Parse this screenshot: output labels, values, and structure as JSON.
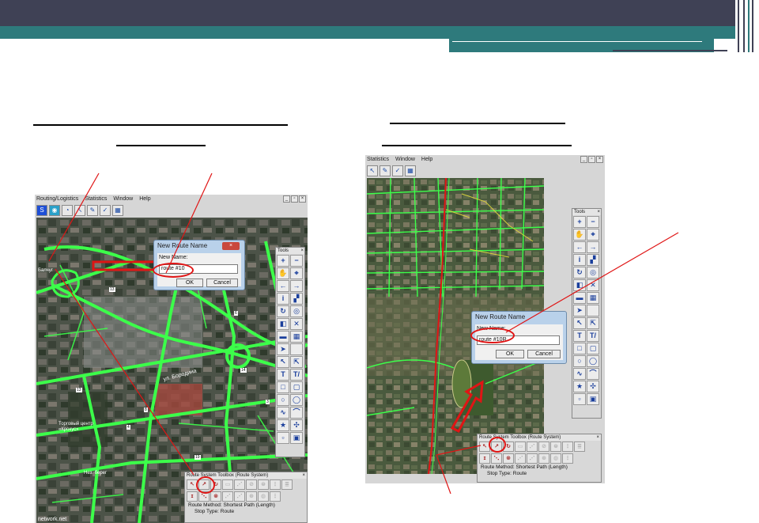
{
  "left_window": {
    "menu": [
      "Routing/Logistics",
      "Statistics",
      "Window",
      "Help"
    ],
    "window_controls": [
      "_",
      "▫",
      "×"
    ],
    "toolbar_icons": [
      "layer-icon",
      "globe-icon",
      "zoom-icon",
      "select-icon",
      "edit-icon",
      "check-icon",
      "grid-icon"
    ],
    "map_labels": {
      "left_edge": "Балчуг",
      "mall": "Торговый центр «Крокус»",
      "street": "ул. Бородина",
      "bottom": "Нез. берег",
      "footer": "network.net"
    },
    "map_badges": [
      "13",
      "6",
      "14",
      "8",
      "19",
      "13",
      "4",
      "3",
      "7",
      "15",
      "3",
      "7",
      "1",
      "16",
      "8"
    ],
    "dialog": {
      "title": "New Route Name",
      "close": "×",
      "label": "New Name:",
      "value": "route #10",
      "ok": "OK",
      "cancel": "Cancel"
    },
    "route_toolbox": {
      "title": "Route System Toolbox (Route System)",
      "close": "×",
      "method_label": "Route Method:",
      "method_value": "Shortest Path (Length)",
      "stop_label": "Stop Type:",
      "stop_value": "Route"
    },
    "tools": {
      "title": "Tools",
      "close": "×"
    }
  },
  "right_window": {
    "menu": [
      "Statistics",
      "Window",
      "Help"
    ],
    "window_controls": [
      "_",
      "▫",
      "×"
    ],
    "toolbar_icons": [
      "select-icon",
      "edit-icon",
      "check-icon",
      "grid-icon"
    ],
    "dialog": {
      "title": "New Route Name",
      "label": "New Name:",
      "value": "route #10R",
      "ok": "OK",
      "cancel": "Cancel"
    },
    "route_toolbox": {
      "title": "Route System Toolbox (Route System)",
      "close": "×",
      "method_label": "Route Method:",
      "method_value": "Shortest Path (Length)",
      "stop_label": "Stop Type:",
      "stop_value": "Route"
    },
    "tools": {
      "title": "Tools",
      "close": "×"
    }
  },
  "tool_glyphs": [
    "+",
    "−",
    "✋",
    "⌖",
    "←",
    "→",
    "i",
    "▞",
    "↻",
    "◎",
    "◧",
    "✕",
    "▬",
    "▦",
    "➤",
    "",
    "↖",
    "⇱",
    "T",
    "T/",
    "□",
    "▢",
    "○",
    "◯",
    "∿",
    "⌒",
    "★",
    "✣",
    "▫",
    "▣"
  ],
  "route_glyphs_row1": [
    "↖",
    "↗",
    "↻",
    "▭",
    "⋰",
    "⊘",
    "⊜",
    "⋮",
    "≣"
  ],
  "route_glyphs_row2": [
    "ɪ",
    "⋱",
    "⊗",
    "⋰",
    "⋰",
    "⊛",
    "◍",
    "⋮"
  ],
  "colors": {
    "slide_dark": "#3f4155",
    "slide_teal": "#2e7a7c",
    "annotation_red": "#e01515",
    "road_green": "#3cff4a",
    "road_yellow": "#e2d93a"
  }
}
